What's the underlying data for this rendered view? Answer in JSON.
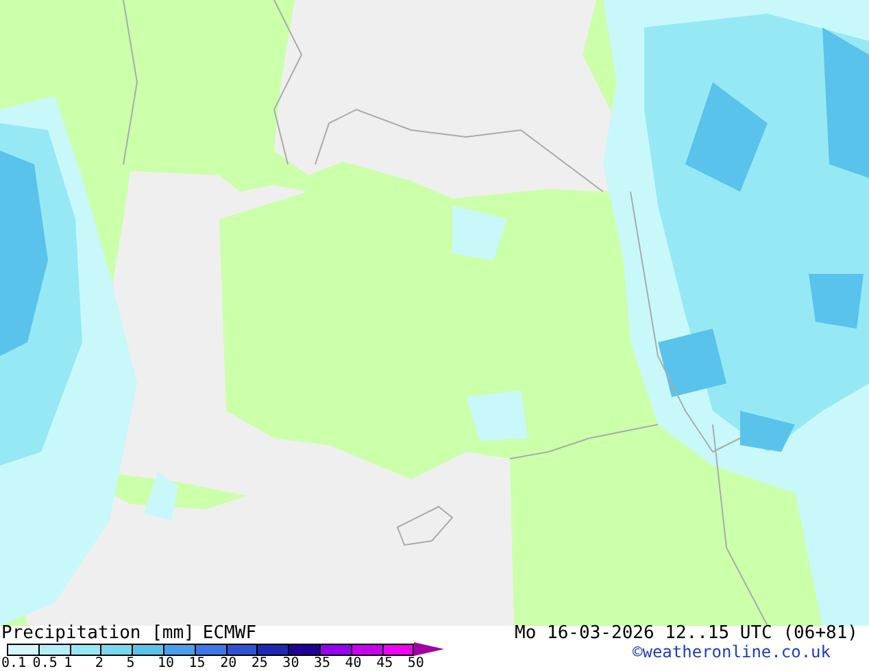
{
  "legend": {
    "title": "Precipitation [mm]",
    "model": "ECMWF",
    "valid_time": "Mo 16-03-2026 12..15 UTC (06+81)",
    "credit": "©weatheronline.co.uk",
    "bins": [
      {
        "color": "#d4f7fa"
      },
      {
        "color": "#b4f0fa"
      },
      {
        "color": "#96e8f5"
      },
      {
        "color": "#78d8f0"
      },
      {
        "color": "#5ac3eb"
      },
      {
        "color": "#4ba0eb"
      },
      {
        "color": "#3c78e6"
      },
      {
        "color": "#3250d2"
      },
      {
        "color": "#1e28b4"
      },
      {
        "color": "#1e0096"
      },
      {
        "color": "#9600f0"
      },
      {
        "color": "#c800f0"
      },
      {
        "color": "#f000f0"
      }
    ],
    "ticks": [
      "0.1",
      "0.5",
      "1",
      "2",
      "5",
      "10",
      "15",
      "20",
      "25",
      "30",
      "35",
      "40",
      "45",
      "50"
    ]
  }
}
